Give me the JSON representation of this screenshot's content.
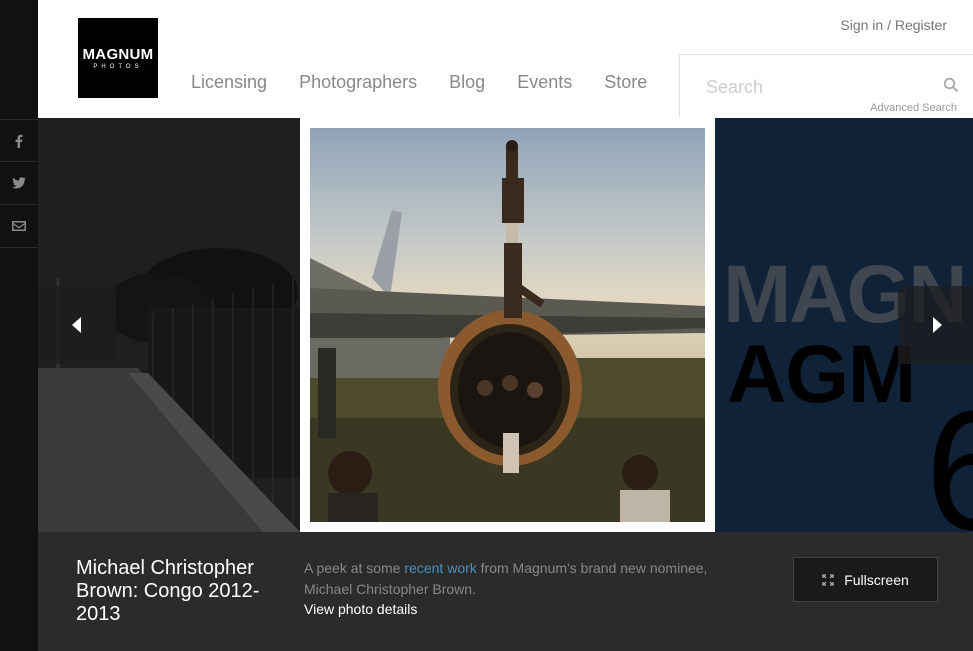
{
  "social": {
    "items": [
      {
        "icon": "facebook-icon"
      },
      {
        "icon": "twitter-icon"
      },
      {
        "icon": "email-icon"
      }
    ]
  },
  "header": {
    "logo_line1": "MAGNUM",
    "logo_line2": "PHOTOS",
    "nav": [
      "Licensing",
      "Photographers",
      "Blog",
      "Events",
      "Store"
    ],
    "sign_in": "Sign in",
    "separator": " / ",
    "register": "Register",
    "search_placeholder": "Search",
    "advanced_search": "Advanced Search"
  },
  "slider": {
    "right_text_1": "MAGN",
    "right_text_2": "AGM",
    "right_text_3": "6"
  },
  "info": {
    "title": "Michael Christopher Brown: Congo 2012-2013",
    "desc_before": "A peek at some ",
    "desc_link": "recent work",
    "desc_after": " from Magnum's brand new nominee, Michael Christopher Brown.",
    "view_details": "View photo details",
    "fullscreen": "Fullscreen"
  },
  "colors": {
    "link_accent": "#4a8fba",
    "info_bg": "#2b2b2b",
    "sidebar_bg": "#111111"
  }
}
